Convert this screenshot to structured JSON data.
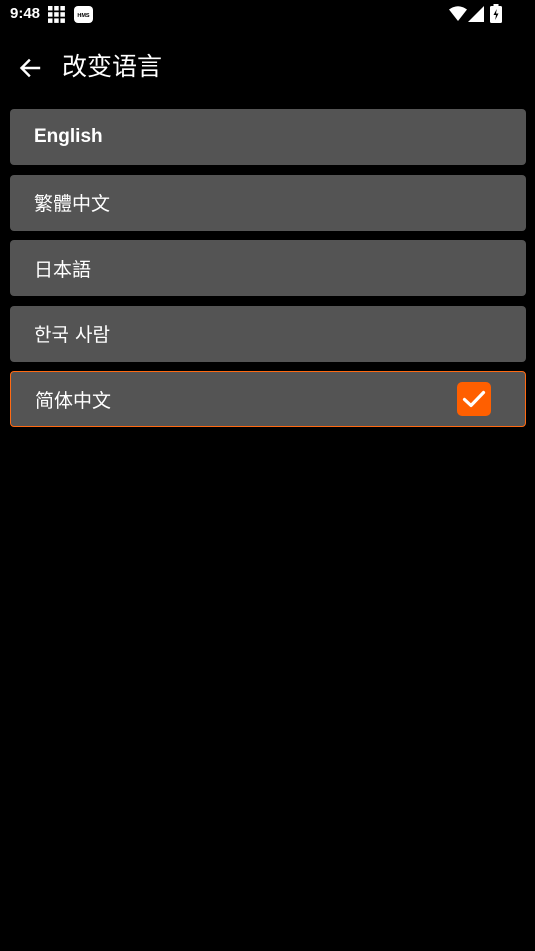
{
  "status_bar": {
    "time": "9:48",
    "icons": [
      "grid-icon",
      "hms-icon",
      "wifi-icon",
      "signal-icon",
      "battery-icon"
    ],
    "hms_text": "HMS"
  },
  "app_bar": {
    "back_icon": "arrow-left-icon",
    "title": "改变语言"
  },
  "languages": [
    {
      "label": "English",
      "selected": false
    },
    {
      "label": "繁體中文",
      "selected": false
    },
    {
      "label": "日本語",
      "selected": false
    },
    {
      "label": "한국 사람",
      "selected": false
    },
    {
      "label": "简体中文",
      "selected": true
    }
  ],
  "colors": {
    "background": "#000000",
    "item_background": "#545454",
    "accent": "#ff5f00"
  }
}
